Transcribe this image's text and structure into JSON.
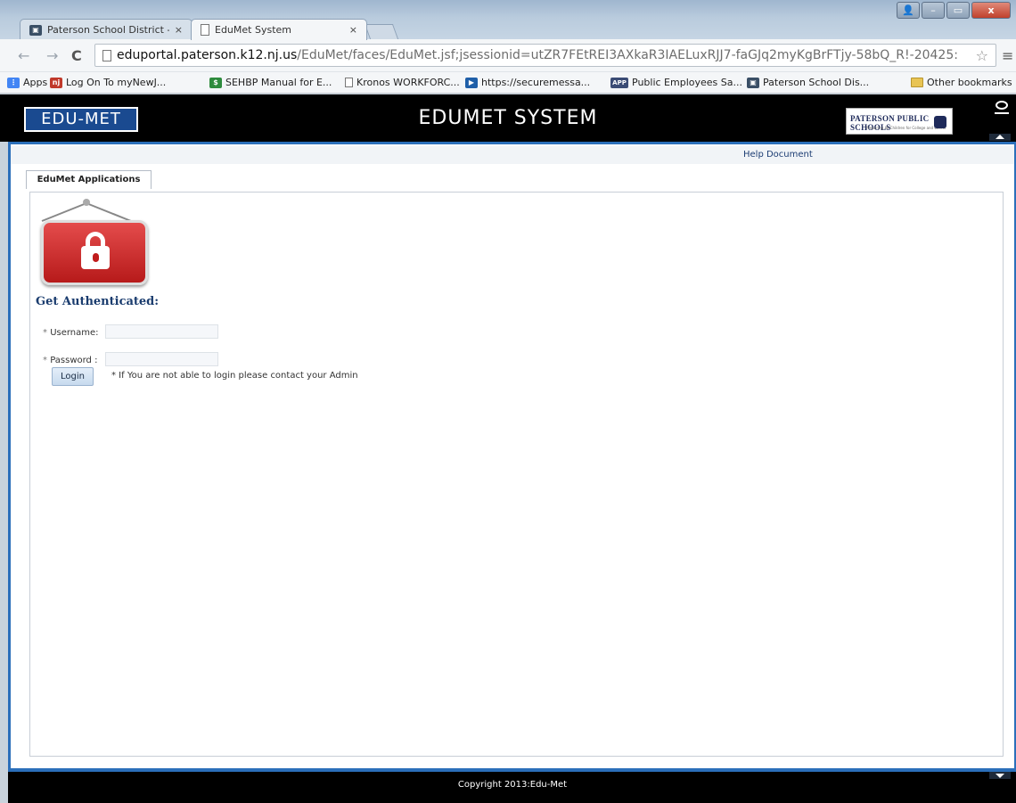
{
  "browser": {
    "tabs": [
      {
        "title": "Paterson School District - ",
        "active": false
      },
      {
        "title": "EduMet System",
        "active": true
      }
    ],
    "close_glyph": "×",
    "url_host": "eduportal.paterson.k12.nj.us",
    "url_path": "/EduMet/faces/EduMet.jsf;jsessionid=utZR7FEtREI3AXkaR3IAELuxRJJ7-faGJq2myKgBrFTjy-58bQ_R!-20425:",
    "bookmarks": [
      {
        "label": "Apps",
        "icon": "apps-grid-icon",
        "color": "#4285f4"
      },
      {
        "label": "Log On To myNewJ...",
        "icon": "nj-icon",
        "color": "#c0392b"
      },
      {
        "label": "SEHBP Manual for E...",
        "icon": "sehbp-icon",
        "color": "#2e8b3d"
      },
      {
        "label": "Kronos WORKFORC...",
        "icon": "page-icon",
        "color": "#888888"
      },
      {
        "label": "https://securemessa...",
        "icon": "arrow-icon",
        "color": "#1f5fa8"
      },
      {
        "label": "Public Employees Sa...",
        "icon": "app-icon",
        "color": "#3b4c75"
      },
      {
        "label": "Paterson School Dis...",
        "icon": "school-icon",
        "color": "#3a4f66"
      }
    ],
    "other_bookmarks": "Other bookmarks"
  },
  "header": {
    "logo_text": "EDU-MET",
    "title": "EDUMET SYSTEM",
    "school_logo_text": "PATERSON PUBLIC SCHOOLS",
    "school_logo_subtext": "Preparing All Children for College and Career"
  },
  "help": {
    "label": "Help Document"
  },
  "app_tab": {
    "label": "EduMet Applications"
  },
  "auth": {
    "title": "Get Authenticated:",
    "username_label": "Username:",
    "password_label": "Password :",
    "required_mark": "*",
    "username_value": "",
    "password_value": "",
    "login_label": "Login",
    "note": "* If You are not able to login please contact your Admin"
  },
  "footer": {
    "copyright": "Copyright 2013:Edu-Met"
  },
  "colors": {
    "frame_blue": "#2b6fba",
    "title_blue": "#1a3c6e",
    "lock_red": "#d32f2f"
  }
}
